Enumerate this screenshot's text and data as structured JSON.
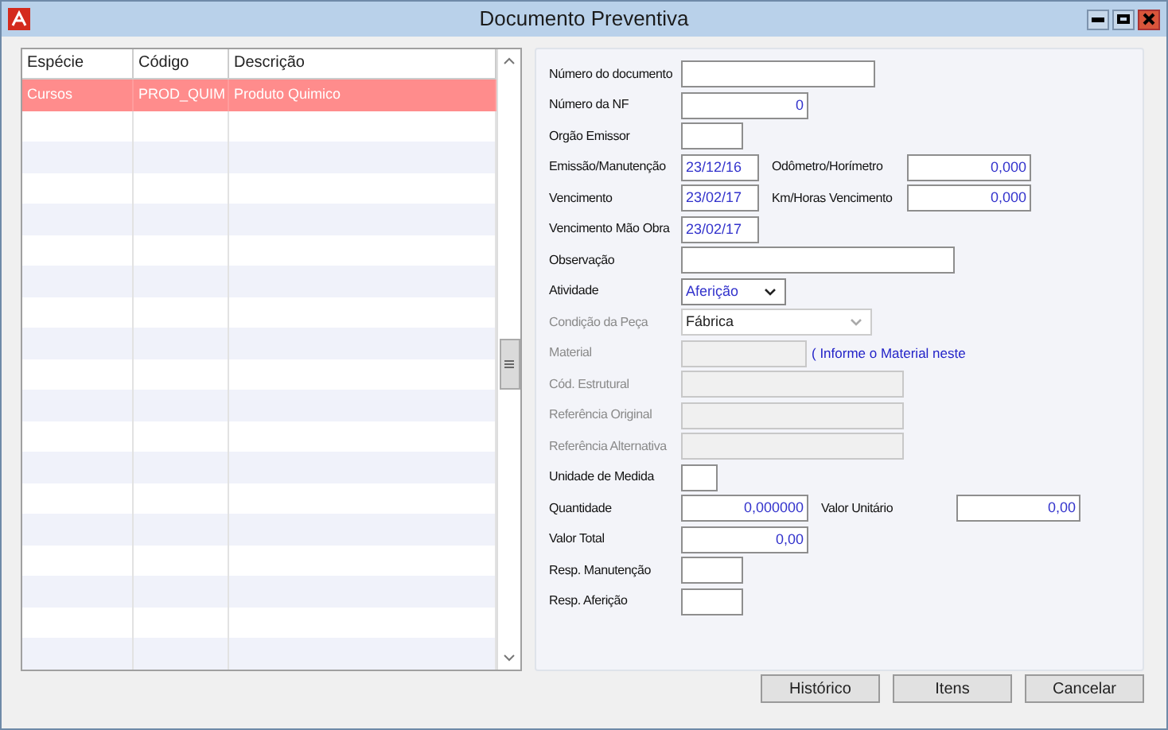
{
  "window": {
    "title": "Documento Preventiva"
  },
  "grid": {
    "columns": [
      "Espécie",
      "Código",
      "Descrição"
    ],
    "rows": [
      {
        "cells": [
          "Cursos",
          "PROD_QUIM",
          "Produto Quimico"
        ],
        "selected": true
      }
    ]
  },
  "form": {
    "rows": [
      {
        "fields": [
          {
            "label": "Número do documento",
            "kind": "text",
            "disabled": false
          }
        ]
      },
      {
        "fields": [
          {
            "label": "Número da NF",
            "value": "0",
            "kind": "number",
            "disabled": false
          }
        ]
      },
      {
        "fields": [
          {
            "label": "Orgão Emissor",
            "kind": "text",
            "disabled": false
          }
        ]
      },
      {
        "fields": [
          {
            "label": "Emissão/Manutenção",
            "value": "23/12/16",
            "kind": "date",
            "disabled": false
          },
          {
            "label": "Odômetro/Horímetro",
            "value": "0,000",
            "kind": "number",
            "disabled": false
          }
        ]
      },
      {
        "fields": [
          {
            "label": "Vencimento",
            "value": "23/02/17",
            "kind": "date",
            "disabled": false
          },
          {
            "label": "Km/Horas Vencimento",
            "value": "0,000",
            "kind": "number",
            "disabled": false
          }
        ]
      },
      {
        "fields": [
          {
            "label": "Vencimento Mão Obra",
            "value": "23/02/17",
            "kind": "date",
            "disabled": false
          }
        ]
      },
      {
        "fields": [
          {
            "label": "Observação",
            "kind": "text",
            "disabled": false
          }
        ]
      },
      {
        "fields": [
          {
            "label": "Atividade",
            "value": "Aferição",
            "kind": "select",
            "disabled": false
          }
        ]
      },
      {
        "fields": [
          {
            "label": "Condição da Peça",
            "value": "Fábrica",
            "kind": "select",
            "disabled": true
          }
        ]
      },
      {
        "fields": [
          {
            "label": "Material",
            "kind": "text",
            "disabled": true
          }
        ],
        "note": "( Informe o Material neste"
      },
      {
        "fields": [
          {
            "label": "Cód. Estrutural",
            "kind": "text",
            "disabled": true
          }
        ]
      },
      {
        "fields": [
          {
            "label": "Referência Original",
            "kind": "text",
            "disabled": true
          }
        ]
      },
      {
        "fields": [
          {
            "label": "Referência Alternativa",
            "kind": "text",
            "disabled": true
          }
        ]
      },
      {
        "fields": [
          {
            "label": "Unidade de Medida",
            "kind": "text",
            "disabled": false
          }
        ]
      },
      {
        "fields": [
          {
            "label": "Quantidade",
            "value": "0,000000",
            "kind": "number",
            "disabled": false
          },
          {
            "label": "Valor Unitário",
            "value": "0,00",
            "kind": "number",
            "disabled": false
          }
        ]
      },
      {
        "fields": [
          {
            "label": "Valor Total",
            "value": "0,00",
            "kind": "number",
            "disabled": false
          }
        ]
      },
      {
        "fields": [
          {
            "label": "Resp. Manutenção",
            "kind": "text",
            "disabled": false
          }
        ]
      },
      {
        "fields": [
          {
            "label": "Resp. Aferição",
            "kind": "text",
            "disabled": false
          }
        ]
      }
    ]
  },
  "buttons": [
    "Histórico",
    "Itens",
    "Cancelar"
  ]
}
